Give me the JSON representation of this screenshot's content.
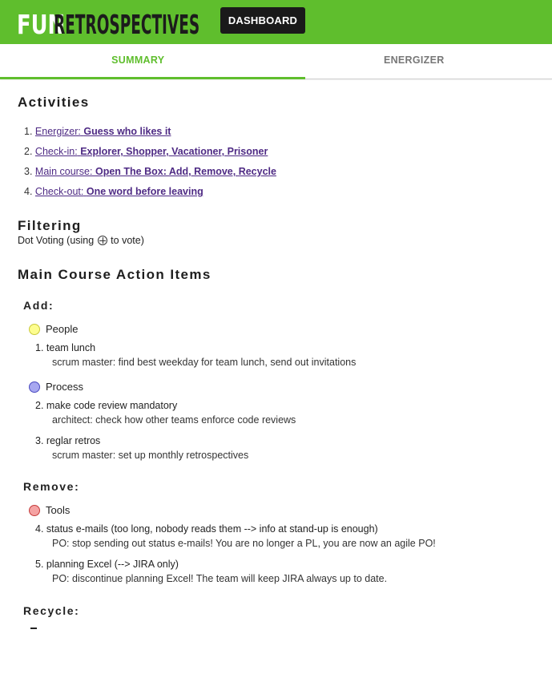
{
  "header": {
    "logo_fun": "FUN",
    "logo_retro": "RETROSPECTIVES",
    "dashboard_label": "DASHBOARD"
  },
  "tabs": [
    {
      "label": "SUMMARY",
      "active": true
    },
    {
      "label": "ENERGIZER",
      "active": false
    }
  ],
  "activities": {
    "title": "Activities",
    "items": [
      {
        "num": "1.",
        "type": "Energizer:",
        "name": "Guess who likes it"
      },
      {
        "num": "2.",
        "type": "Check-in:",
        "name": "Explorer, Shopper, Vacationer, Prisoner"
      },
      {
        "num": "3.",
        "type": "Main course:",
        "name": "Open The Box: Add, Remove, Recycle"
      },
      {
        "num": "4.",
        "type": "Check-out:",
        "name": "One word before leaving"
      }
    ]
  },
  "filtering": {
    "title": "Filtering",
    "text_before": "Dot Voting (using",
    "text_after": "to vote)"
  },
  "action_items": {
    "title": "Main Course Action Items",
    "add": {
      "label": "Add:",
      "categories": [
        {
          "name": "People",
          "color": "#fdfd8f",
          "border": "#c9c93b",
          "items": [
            {
              "num": "1.",
              "title": "team lunch",
              "desc": "scrum master: find best weekday for team lunch, send out invitations"
            }
          ]
        },
        {
          "name": "Process",
          "color": "#a7a7f0",
          "border": "#4a4ac0",
          "items": [
            {
              "num": "2.",
              "title": "make code review mandatory",
              "desc": "architect: check how other teams enforce code reviews"
            },
            {
              "num": "3.",
              "title": "reglar retros",
              "desc": "scrum master: set up monthly retrospectives"
            }
          ]
        }
      ]
    },
    "remove": {
      "label": "Remove:",
      "categories": [
        {
          "name": "Tools",
          "color": "#f5a3a3",
          "border": "#c43a3a",
          "items": [
            {
              "num": "4.",
              "title": "status e-mails (too long, nobody reads them --> info at stand-up is enough)",
              "desc": "PO: stop sending out status e-mails! You are no longer a PL, you are now an agile PO!"
            },
            {
              "num": "5.",
              "title": "planning Excel (--> JIRA only)",
              "desc": "PO: discontinue planning Excel! The team will keep JIRA always up to date."
            }
          ]
        }
      ]
    },
    "recycle": {
      "label": "Recycle:"
    }
  }
}
